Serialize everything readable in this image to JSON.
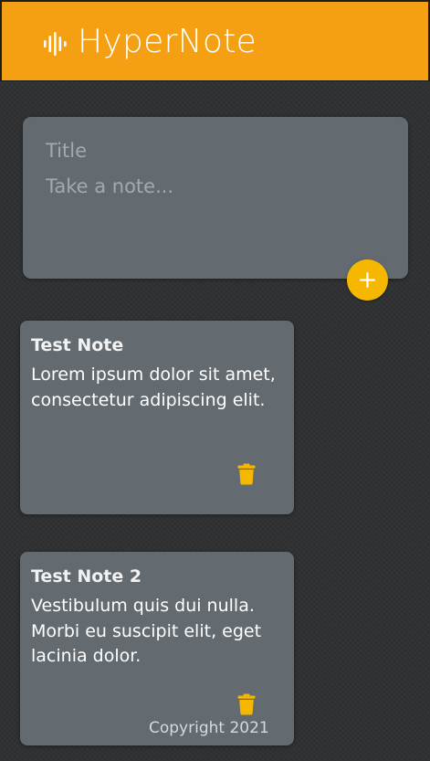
{
  "app": {
    "title": "HyperNote",
    "logo_icon": "sound-wave-icon"
  },
  "colors": {
    "header_bg": "#f5a012",
    "page_bg": "#2f3133",
    "card_bg": "#636a70",
    "accent": "#f5b700"
  },
  "composer": {
    "title_placeholder": "Title",
    "content_placeholder": "Take a note...",
    "add_icon": "plus-icon"
  },
  "notes": [
    {
      "title": "Test Note",
      "content": "Lorem ipsum dolor sit amet, consectetur adipiscing elit.",
      "delete_icon": "trash-icon"
    },
    {
      "title": "Test Note 2",
      "content": "Vestibulum quis dui nulla. Morbi eu suscipit elit, eget lacinia dolor.",
      "delete_icon": "trash-icon"
    }
  ],
  "footer": {
    "text": "Copyright 2021"
  }
}
